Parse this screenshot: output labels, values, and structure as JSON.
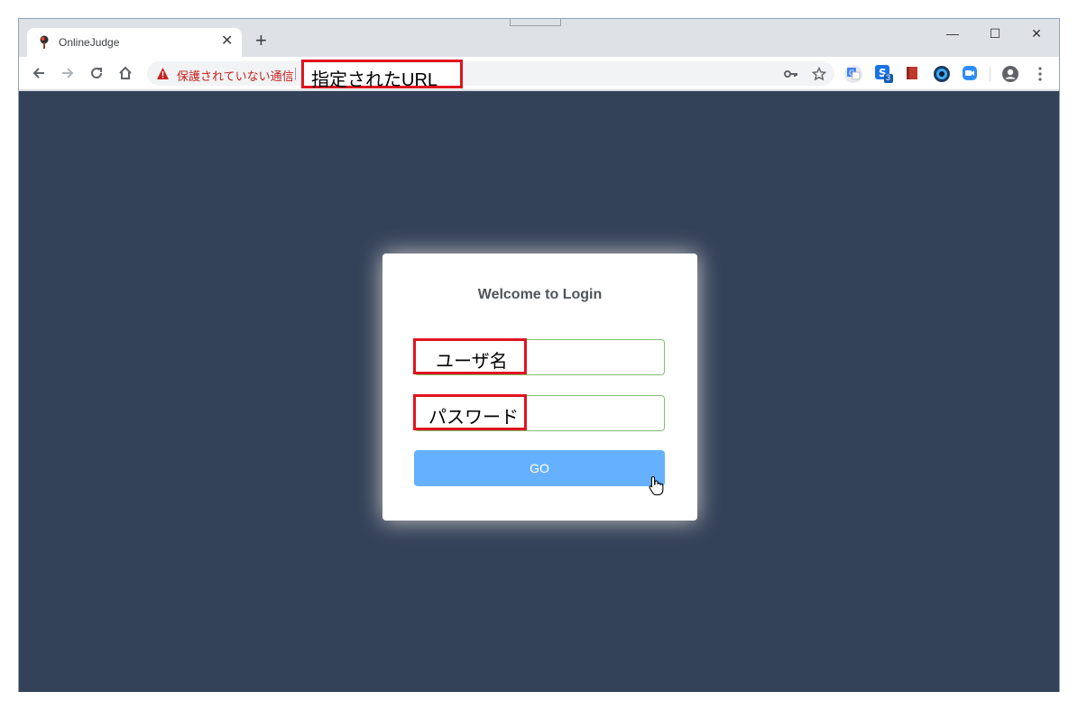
{
  "browser": {
    "tab_title": "OnlineJudge",
    "tab_close": "✕",
    "new_tab": "+",
    "controls": {
      "minimize": "—",
      "maximize": "☐",
      "close": "✕"
    },
    "security_text": "保護されていない通信",
    "url_annotation": "指定されたURL",
    "extension_badge": "3"
  },
  "login": {
    "title": "Welcome to Login",
    "username_annotation": "ユーザ名",
    "password_annotation": "パスワード",
    "go_label": "GO"
  },
  "colors": {
    "page_bg": "#344259",
    "button": "#66b1ff",
    "annotation_border": "#e0141e",
    "field_border": "#7fc16c",
    "insecure_text": "#c5221f"
  },
  "icons": [
    "back-arrow-icon",
    "forward-arrow-icon",
    "reload-icon",
    "home-icon",
    "warning-icon",
    "key-icon",
    "star-icon",
    "translate-icon",
    "extension-s-icon",
    "book-icon",
    "camera-icon",
    "zoom-icon",
    "profile-icon",
    "menu-icon",
    "hand-cursor-icon"
  ]
}
